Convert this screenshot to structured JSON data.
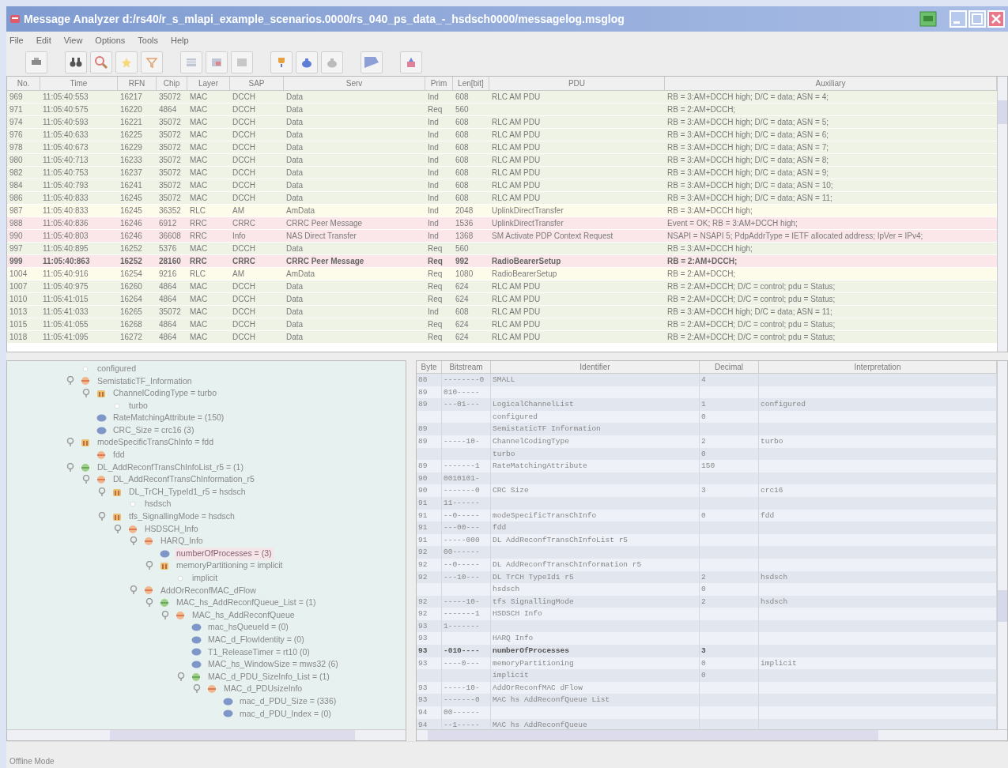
{
  "window": {
    "title": "Message Analyzer d:/rs40/r_s_mlapi_example_scenarios.0000/rs_040_ps_data_-_hsdsch0000/messagelog.msglog"
  },
  "menu": [
    "File",
    "Edit",
    "View",
    "Options",
    "Tools",
    "Help"
  ],
  "messages": {
    "columns": [
      "No.",
      "Time",
      "RFN",
      "Chip",
      "Layer",
      "SAP",
      "Serv",
      "Prim",
      "Len[bit]",
      "PDU",
      "Auxiliary"
    ],
    "rows": [
      {
        "cells": [
          "969",
          "11:05:40:553",
          "16217",
          "35072",
          "MAC",
          "DCCH",
          "Data",
          "Ind",
          "608",
          "RLC AM PDU",
          "RB = 3:AM+DCCH high; D/C = data; ASN = 4;"
        ],
        "color": "#eef3e6",
        "selected": false
      },
      {
        "cells": [
          "971",
          "11:05:40:575",
          "16220",
          "4864",
          "MAC",
          "DCCH",
          "Data",
          "Req",
          "560",
          "",
          "RB = 2:AM+DCCH;"
        ],
        "color": "#eef3e6",
        "selected": false
      },
      {
        "cells": [
          "974",
          "11:05:40:593",
          "16221",
          "35072",
          "MAC",
          "DCCH",
          "Data",
          "Ind",
          "608",
          "RLC AM PDU",
          "RB = 3:AM+DCCH high; D/C = data; ASN = 5;"
        ],
        "color": "#eef3e6",
        "selected": false
      },
      {
        "cells": [
          "976",
          "11:05:40:633",
          "16225",
          "35072",
          "MAC",
          "DCCH",
          "Data",
          "Ind",
          "608",
          "RLC AM PDU",
          "RB = 3:AM+DCCH high; D/C = data; ASN = 6;"
        ],
        "color": "#eef3e6",
        "selected": false
      },
      {
        "cells": [
          "978",
          "11:05:40:673",
          "16229",
          "35072",
          "MAC",
          "DCCH",
          "Data",
          "Ind",
          "608",
          "RLC AM PDU",
          "RB = 3:AM+DCCH high; D/C = data; ASN = 7;"
        ],
        "color": "#eef3e6",
        "selected": false
      },
      {
        "cells": [
          "980",
          "11:05:40:713",
          "16233",
          "35072",
          "MAC",
          "DCCH",
          "Data",
          "Ind",
          "608",
          "RLC AM PDU",
          "RB = 3:AM+DCCH high; D/C = data; ASN = 8;"
        ],
        "color": "#eef3e6",
        "selected": false
      },
      {
        "cells": [
          "982",
          "11:05:40:753",
          "16237",
          "35072",
          "MAC",
          "DCCH",
          "Data",
          "Ind",
          "608",
          "RLC AM PDU",
          "RB = 3:AM+DCCH high; D/C = data; ASN = 9;"
        ],
        "color": "#eef3e6",
        "selected": false
      },
      {
        "cells": [
          "984",
          "11:05:40:793",
          "16241",
          "35072",
          "MAC",
          "DCCH",
          "Data",
          "Ind",
          "608",
          "RLC AM PDU",
          "RB = 3:AM+DCCH high; D/C = data; ASN = 10;"
        ],
        "color": "#eef3e6",
        "selected": false
      },
      {
        "cells": [
          "986",
          "11:05:40:833",
          "16245",
          "35072",
          "MAC",
          "DCCH",
          "Data",
          "Ind",
          "608",
          "RLC AM PDU",
          "RB = 3:AM+DCCH high; D/C = data; ASN = 11;"
        ],
        "color": "#eef3e6",
        "selected": false
      },
      {
        "cells": [
          "987",
          "11:05:40:833",
          "16245",
          "36352",
          "RLC",
          "AM",
          "AmData",
          "Ind",
          "2048",
          "UplinkDirectTransfer",
          "RB = 3:AM+DCCH high;"
        ],
        "color": "#fdfbea",
        "selected": false
      },
      {
        "cells": [
          "988",
          "11:05:40:836",
          "16246",
          "6912",
          "RRC",
          "CRRC",
          "CRRC Peer Message",
          "Ind",
          "1536",
          "UplinkDirectTransfer",
          "Event = OK; RB = 3:AM+DCCH high;"
        ],
        "color": "#fbe7ea",
        "selected": false
      },
      {
        "cells": [
          "990",
          "11:05:40:803",
          "16246",
          "36608",
          "RRC",
          "Info",
          "NAS Direct Transfer",
          "Ind",
          "1368",
          "SM Activate PDP Context Request",
          "NSAPI = NSAPI  5; PdpAddrType = IETF allocated address; IpVer = IPv4;"
        ],
        "color": "#fbe7ea",
        "selected": false
      },
      {
        "cells": [
          "997",
          "11:05:40:895",
          "16252",
          "5376",
          "MAC",
          "DCCH",
          "Data",
          "Req",
          "560",
          "",
          "RB = 3:AM+DCCH high;"
        ],
        "color": "#eef3e6",
        "selected": false
      },
      {
        "cells": [
          "999",
          "11:05:40:863",
          "16252",
          "28160",
          "RRC",
          "CRRC",
          "CRRC Peer Message",
          "Req",
          "992",
          "RadioBearerSetup",
          "RB = 2:AM+DCCH;"
        ],
        "color": "#fbe7ea",
        "selected": true
      },
      {
        "cells": [
          "1004",
          "11:05:40:916",
          "16254",
          "9216",
          "RLC",
          "AM",
          "AmData",
          "Req",
          "1080",
          "RadioBearerSetup",
          "RB = 2:AM+DCCH;"
        ],
        "color": "#fdfbea",
        "selected": false
      },
      {
        "cells": [
          "1007",
          "11:05:40:975",
          "16260",
          "4864",
          "MAC",
          "DCCH",
          "Data",
          "Req",
          "624",
          "RLC AM PDU",
          "RB = 2:AM+DCCH; D/C = control; pdu = Status;"
        ],
        "color": "#eef3e6",
        "selected": false
      },
      {
        "cells": [
          "1010",
          "11:05:41:015",
          "16264",
          "4864",
          "MAC",
          "DCCH",
          "Data",
          "Req",
          "624",
          "RLC AM PDU",
          "RB = 2:AM+DCCH; D/C = control; pdu = Status;"
        ],
        "color": "#eef3e6",
        "selected": false
      },
      {
        "cells": [
          "1013",
          "11:05:41:033",
          "16265",
          "35072",
          "MAC",
          "DCCH",
          "Data",
          "Ind",
          "608",
          "RLC AM PDU",
          "RB = 3:AM+DCCH high; D/C = data; ASN = 11;"
        ],
        "color": "#eef3e6",
        "selected": false
      },
      {
        "cells": [
          "1015",
          "11:05:41:055",
          "16268",
          "4864",
          "MAC",
          "DCCH",
          "Data",
          "Req",
          "624",
          "RLC AM PDU",
          "RB = 2:AM+DCCH; D/C = control; pdu = Status;"
        ],
        "color": "#eef3e6",
        "selected": false
      },
      {
        "cells": [
          "1018",
          "11:05:41:095",
          "16272",
          "4864",
          "MAC",
          "DCCH",
          "Data",
          "Req",
          "624",
          "RLC AM PDU",
          "RB = 2:AM+DCCH; D/C = control; pdu = Status;"
        ],
        "color": "#eef3e6",
        "selected": false
      }
    ]
  },
  "tree": {
    "items": [
      {
        "label": "configured",
        "kind": "value",
        "selected": false
      },
      {
        "label": "SemistaticTF_Information",
        "kind": "enum",
        "selected": false,
        "expanded": true,
        "children": [
          {
            "label": "ChannelCodingType = turbo",
            "kind": "choice",
            "selected": false,
            "expanded": true,
            "children": [
              {
                "label": "turbo",
                "kind": "value",
                "selected": false
              }
            ]
          },
          {
            "label": "RateMatchingAttribute = (150)",
            "kind": "leaf",
            "selected": false
          },
          {
            "label": "CRC_Size = crc16 (3)",
            "kind": "leaf",
            "selected": false
          }
        ]
      },
      {
        "label": "modeSpecificTransChInfo = fdd",
        "kind": "choice",
        "selected": false,
        "expanded": true,
        "children": [
          {
            "label": "fdd",
            "kind": "enum",
            "selected": false
          }
        ]
      },
      {
        "label": "DL_AddReconfTransChInfoList_r5 = (1)",
        "kind": "seq",
        "selected": false,
        "expanded": true,
        "children": [
          {
            "label": "DL_AddReconfTransChInformation_r5",
            "kind": "enum",
            "selected": false,
            "expanded": true,
            "children": [
              {
                "label": "DL_TrCH_TypeId1_r5 = hsdsch",
                "kind": "choice",
                "selected": false,
                "expanded": true,
                "children": [
                  {
                    "label": "hsdsch",
                    "kind": "value",
                    "selected": false
                  }
                ]
              },
              {
                "label": "tfs_SignallingMode = hsdsch",
                "kind": "choice",
                "selected": false,
                "expanded": true,
                "children": [
                  {
                    "label": "HSDSCH_Info",
                    "kind": "enum",
                    "selected": false,
                    "expanded": true,
                    "children": [
                      {
                        "label": "HARQ_Info",
                        "kind": "enum",
                        "selected": false,
                        "expanded": true,
                        "children": [
                          {
                            "label": "numberOfProcesses = (3)",
                            "kind": "leaf",
                            "selected": true
                          },
                          {
                            "label": "memoryPartitioning = implicit",
                            "kind": "choice",
                            "selected": false,
                            "expanded": true,
                            "children": [
                              {
                                "label": "implicit",
                                "kind": "value",
                                "selected": false
                              }
                            ]
                          }
                        ]
                      },
                      {
                        "label": "AddOrReconfMAC_dFlow",
                        "kind": "enum",
                        "selected": false,
                        "expanded": true,
                        "children": [
                          {
                            "label": "MAC_hs_AddReconfQueue_List = (1)",
                            "kind": "seq",
                            "selected": false,
                            "expanded": true,
                            "children": [
                              {
                                "label": "MAC_hs_AddReconfQueue",
                                "kind": "enum",
                                "selected": false,
                                "expanded": true,
                                "children": [
                                  {
                                    "label": "mac_hsQueueId = (0)",
                                    "kind": "leaf",
                                    "selected": false
                                  },
                                  {
                                    "label": "MAC_d_FlowIdentity = (0)",
                                    "kind": "leaf",
                                    "selected": false
                                  },
                                  {
                                    "label": "T1_ReleaseTimer = rt10 (0)",
                                    "kind": "leaf",
                                    "selected": false
                                  },
                                  {
                                    "label": "MAC_hs_WindowSize = mws32 (6)",
                                    "kind": "leaf",
                                    "selected": false
                                  },
                                  {
                                    "label": "MAC_d_PDU_SizeInfo_List = (1)",
                                    "kind": "seq",
                                    "selected": false,
                                    "expanded": true,
                                    "children": [
                                      {
                                        "label": "MAC_d_PDUsizeInfo",
                                        "kind": "enum",
                                        "selected": false,
                                        "expanded": true,
                                        "children": [
                                          {
                                            "label": "mac_d_PDU_Size = (336)",
                                            "kind": "leaf",
                                            "selected": false
                                          },
                                          {
                                            "label": "mac_d_PDU_Index = (0)",
                                            "kind": "leaf",
                                            "selected": false
                                          }
                                        ]
                                      }
                                    ]
                                  }
                                ]
                              }
                            ]
                          }
                        ]
                      }
                    ]
                  }
                ]
              }
            ]
          }
        ]
      }
    ]
  },
  "bits": {
    "columns": [
      "Byte",
      "Bitstream",
      "Identifier",
      "Decimal",
      "Interpretation"
    ],
    "rows": [
      {
        "cells": [
          "88",
          "--------0",
          "SMALL",
          "4",
          ""
        ],
        "selected": false
      },
      {
        "cells": [
          "89",
          "010-----",
          "",
          "",
          ""
        ],
        "selected": false
      },
      {
        "cells": [
          "89",
          "---01---",
          "LogicalChannelList",
          "1",
          "configured"
        ],
        "selected": false
      },
      {
        "cells": [
          "",
          "",
          "configured",
          "0",
          ""
        ],
        "selected": false
      },
      {
        "cells": [
          "89",
          "",
          "SemistaticTF Information",
          "",
          ""
        ],
        "selected": false
      },
      {
        "cells": [
          "89",
          "-----10-",
          "ChannelCodingType",
          "2",
          "turbo"
        ],
        "selected": false
      },
      {
        "cells": [
          "",
          "",
          "turbo",
          "0",
          ""
        ],
        "selected": false
      },
      {
        "cells": [
          "89",
          "-------1",
          "RateMatchingAttribute",
          "150",
          ""
        ],
        "selected": false
      },
      {
        "cells": [
          "90",
          "0010101-",
          "",
          "",
          ""
        ],
        "selected": false
      },
      {
        "cells": [
          "90",
          "-------0",
          "CRC Size",
          "3",
          "crc16"
        ],
        "selected": false
      },
      {
        "cells": [
          "91",
          "11------",
          "",
          "",
          ""
        ],
        "selected": false
      },
      {
        "cells": [
          "91",
          "--0-----",
          "modeSpecificTransChInfo",
          "0",
          "fdd"
        ],
        "selected": false
      },
      {
        "cells": [
          "91",
          "---00---",
          "fdd",
          "",
          ""
        ],
        "selected": false
      },
      {
        "cells": [
          "91",
          "-----000",
          "DL AddReconfTransChInfoList r5",
          "",
          ""
        ],
        "selected": false
      },
      {
        "cells": [
          "92",
          "00------",
          "",
          "",
          ""
        ],
        "selected": false
      },
      {
        "cells": [
          "92",
          "--0-----",
          "DL AddReconfTransChInformation r5",
          "",
          ""
        ],
        "selected": false
      },
      {
        "cells": [
          "92",
          "---10---",
          "DL TrCH TypeId1 r5",
          "2",
          "hsdsch"
        ],
        "selected": false
      },
      {
        "cells": [
          "",
          "",
          "hsdsch",
          "0",
          ""
        ],
        "selected": false
      },
      {
        "cells": [
          "92",
          "-----10-",
          "tfs SignallingMode",
          "2",
          "hsdsch"
        ],
        "selected": false
      },
      {
        "cells": [
          "92",
          "-------1",
          "HSDSCH Info",
          "",
          ""
        ],
        "selected": false
      },
      {
        "cells": [
          "93",
          "1-------",
          "",
          "",
          ""
        ],
        "selected": false
      },
      {
        "cells": [
          "93",
          "",
          "HARQ Info",
          "",
          ""
        ],
        "selected": false
      },
      {
        "cells": [
          "93",
          "-010----",
          "numberOfProcesses",
          "3",
          ""
        ],
        "selected": true
      },
      {
        "cells": [
          "93",
          "----0---",
          "memoryPartitioning",
          "0",
          "implicit"
        ],
        "selected": false
      },
      {
        "cells": [
          "",
          "",
          "implicit",
          "0",
          ""
        ],
        "selected": false
      },
      {
        "cells": [
          "93",
          "-----10-",
          "AddOrReconfMAC dFlow",
          "",
          ""
        ],
        "selected": false
      },
      {
        "cells": [
          "93",
          "-------0",
          "MAC hs AddReconfQueue List",
          "",
          ""
        ],
        "selected": false
      },
      {
        "cells": [
          "94",
          "00------",
          "",
          "",
          ""
        ],
        "selected": false
      },
      {
        "cells": [
          "94",
          "--1-----",
          "MAC hs AddReconfQueue",
          "",
          ""
        ],
        "selected": false
      }
    ]
  },
  "status_bar": "Offline Mode"
}
